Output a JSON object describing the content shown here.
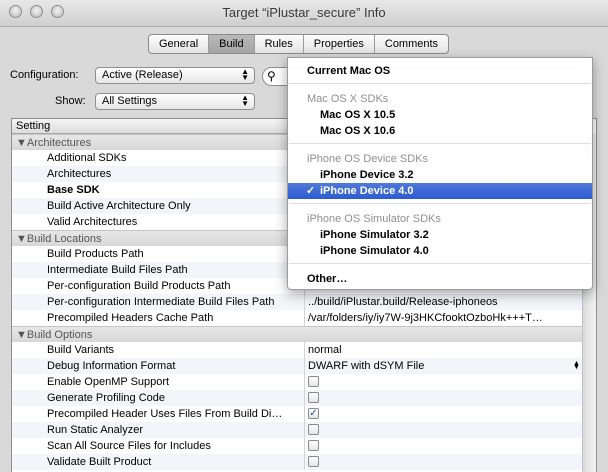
{
  "window": {
    "title": "Target “iPlustar_secure” Info"
  },
  "tabs": [
    {
      "label": "General",
      "selected": false
    },
    {
      "label": "Build",
      "selected": true
    },
    {
      "label": "Rules",
      "selected": false
    },
    {
      "label": "Properties",
      "selected": false
    },
    {
      "label": "Comments",
      "selected": false
    }
  ],
  "toolbar": {
    "configuration_label": "Configuration:",
    "configuration_value": "Active (Release)",
    "show_label": "Show:",
    "show_value": "All Settings"
  },
  "table": {
    "header": "Setting",
    "groups": [
      {
        "name": "Architectures",
        "rows": [
          {
            "name": "Additional SDKs",
            "value": ""
          },
          {
            "name": "Architectures",
            "value": ""
          },
          {
            "name": "Base SDK",
            "value": "",
            "bold": true
          },
          {
            "name": "Build Active Architecture Only",
            "value": ""
          },
          {
            "name": "Valid Architectures",
            "value": ""
          }
        ]
      },
      {
        "name": "Build Locations",
        "rows": [
          {
            "name": "Build Products Path",
            "value": ""
          },
          {
            "name": "Intermediate Build Files Path",
            "value": ""
          },
          {
            "name": "Per-configuration Build Products Path",
            "value": ""
          },
          {
            "name": "Per-configuration Intermediate Build Files Path",
            "value": "../build/iPlustar.build/Release-iphoneos"
          },
          {
            "name": "Precompiled Headers Cache Path",
            "value": "/var/folders/iy/iy7W-9j3HKCfooktOzboHk+++T…"
          }
        ]
      },
      {
        "name": "Build Options",
        "rows": [
          {
            "name": "Build Variants",
            "value": "normal"
          },
          {
            "name": "Debug Information Format",
            "value": "DWARF with dSYM File"
          },
          {
            "name": "Enable OpenMP Support",
            "checkbox": false
          },
          {
            "name": "Generate Profiling Code",
            "checkbox": false
          },
          {
            "name": "Precompiled Header Uses Files From Build Di…",
            "checkbox": true
          },
          {
            "name": "Run Static Analyzer",
            "checkbox": false
          },
          {
            "name": "Scan All Source Files for Includes",
            "checkbox": false
          },
          {
            "name": "Validate Built Product",
            "checkbox": false
          }
        ]
      }
    ]
  },
  "menu": {
    "current": "Current Mac OS",
    "sections": [
      {
        "header": "Mac OS X SDKs",
        "items": [
          "Mac OS X 10.5",
          "Mac OS X 10.6"
        ]
      },
      {
        "header": "iPhone OS Device SDKs",
        "items": [
          "iPhone Device 3.2",
          "iPhone Device 4.0"
        ]
      },
      {
        "header": "iPhone OS Simulator SDKs",
        "items": [
          "iPhone Simulator 3.2",
          "iPhone Simulator 4.0"
        ]
      }
    ],
    "selected_item": "iPhone Device 4.0",
    "other": "Other…"
  }
}
